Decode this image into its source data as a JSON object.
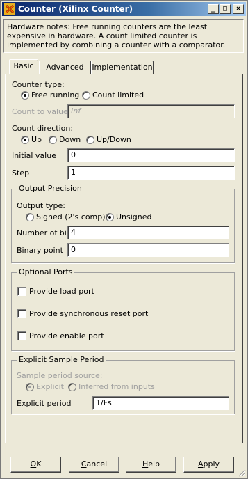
{
  "window": {
    "title": "Counter (Xilinx Counter)",
    "minimize_glyph": "_",
    "maximize_glyph": "□",
    "close_glyph": "×"
  },
  "notes": "Hardware notes: Free running counters are the least expensive in hardware. A count limited counter is implemented by combining a counter with a comparator.",
  "tabs": [
    {
      "label": "Basic",
      "active": true
    },
    {
      "label": "Advanced",
      "active": false
    },
    {
      "label": "Implementation",
      "active": false
    }
  ],
  "basic": {
    "counter_type": {
      "label": "Counter type:",
      "options": [
        "Free running",
        "Count limited"
      ],
      "selected": "Free running"
    },
    "count_to": {
      "label": "Count to value",
      "value": "Inf"
    },
    "count_direction": {
      "label": "Count direction:",
      "options": [
        "Up",
        "Down",
        "Up/Down"
      ],
      "selected": "Up"
    },
    "initial_value": {
      "label": "Initial value",
      "value": "0"
    },
    "step": {
      "label": "Step",
      "value": "1"
    },
    "output_precision": {
      "title": "Output Precision",
      "output_type_label": "Output type:",
      "options": [
        "Signed  (2's comp)",
        "Unsigned"
      ],
      "selected": "Unsigned",
      "number_of_bits": {
        "label": "Number of bits",
        "value": "4"
      },
      "binary_point": {
        "label": "Binary point",
        "value": "0"
      }
    },
    "optional_ports": {
      "title": "Optional Ports",
      "items": [
        "Provide load port",
        "Provide synchronous reset port",
        "Provide enable port"
      ]
    },
    "explicit_sample_period": {
      "title": "Explicit Sample Period",
      "source_label": "Sample period source:",
      "options": [
        "Explicit",
        "Inferred from inputs"
      ],
      "selected": "Explicit",
      "period": {
        "label": "Explicit period",
        "value": "1/Fs"
      }
    }
  },
  "buttons": {
    "ok": {
      "underline": "O",
      "rest": "K"
    },
    "cancel": {
      "underline": "C",
      "rest": "ancel"
    },
    "help": {
      "underline": "H",
      "rest": "elp"
    },
    "apply": {
      "underline": "A",
      "rest": "pply"
    }
  },
  "colors": {
    "titlebar_start": "#0a246a",
    "titlebar_end": "#a6caf0",
    "face": "#ece9d8"
  }
}
